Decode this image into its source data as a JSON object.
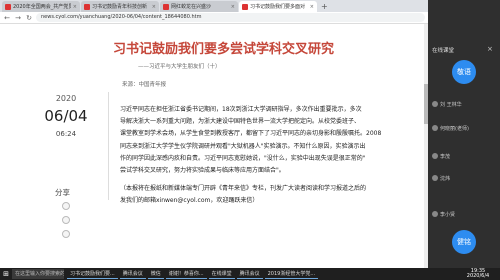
{
  "browser": {
    "tabs": [
      {
        "label": "2020年全国两会_共产党员网"
      },
      {
        "label": "习书记鼓励青年科技创新"
      },
      {
        "label": "网红蛟龙在兴盛沙"
      },
      {
        "label": "习书记鼓励我们要多面对"
      }
    ],
    "new_tab": "+",
    "url": "news.cyol.com/yuanchuang/2020-06/04/content_18644080.htm"
  },
  "article": {
    "title": "习书记鼓励我们要多尝试学科交叉研究",
    "subtitle": "——习近平与大学生朋友们（十）",
    "source": "来源：中国青年报",
    "date_year": "2020",
    "date_md": "06/04",
    "date_time": "06:24",
    "share_label": "分享",
    "paragraphs": [
      "习近平同志在担任浙江省委书记期间，18次到浙江大学调研指导，多次作出重要批示，多次",
      "导解决浙大一系列重大问题，为浙大建设中国特色世界一流大学把舵定向。从校党委班子、",
      "课堂教室到学术会场，从学生食堂到教授客厅，都留下了习近平同志的亲切身影和殷殷嘱托。2008",
      "同志来到浙江大学学生仪学院调研并观看\"大狱机器人\"实验演示。不知什么原因，实验演示出",
      "作的同学因此深感内疚和自责。习近平同志宽慰她说，\"没什么，实验中出现失误是很正常的\"",
      "尝试学科交叉研究，努力将实验成果与临床等应用方面结合\"。"
    ],
    "note_lines": [
      "（本报将在报纸和新媒体端专门开辟《青年来信》专栏，刊发广大读者阅读和学习报道之后的",
      "发我们的邮箱xinwen@cyol.com，欢迎踊跃来信）"
    ]
  },
  "side_panel": {
    "title": "在线课堂",
    "close": "×",
    "participants": [
      {
        "name": "敬语",
        "avatar": true
      },
      {
        "name": "刘 王林华"
      },
      {
        "name": "何晓丽(老师)"
      },
      {
        "name": "李茂"
      },
      {
        "name": "沈炜"
      },
      {
        "name": "李小贤"
      },
      {
        "name": "健铭",
        "avatar": true
      }
    ]
  },
  "taskbar": {
    "start": "⊞",
    "search_placeholder": "在这里输入你要搜索的内容",
    "items": [
      {
        "label": "习书记鼓励我们要..."
      },
      {
        "label": "腾讯会议"
      },
      {
        "label": "微信"
      },
      {
        "label": "谢谢！恭喜你..."
      },
      {
        "label": "在线课堂"
      },
      {
        "label": "腾讯会议"
      },
      {
        "label": "2019浙经管大学党..."
      }
    ],
    "clock_time": "19:35",
    "clock_date": "2020/6/4"
  }
}
